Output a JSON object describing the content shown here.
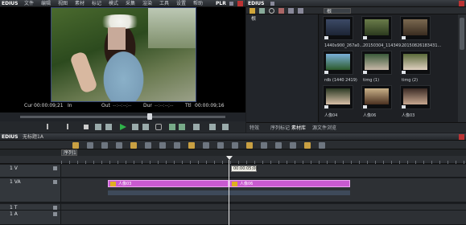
{
  "player": {
    "title_short": "EDIUS",
    "menu": [
      "文件",
      "编辑",
      "视图",
      "素材",
      "标记",
      "模式",
      "采集",
      "渲染",
      "工具",
      "设置",
      "帮助"
    ],
    "mode_label": "PLR",
    "timecodes": {
      "cue_label": "Cur",
      "cue": "00:00:09;21",
      "in_label": "In",
      "out_label": "Out",
      "out": "--:--:--;--",
      "dur_label": "Dur",
      "dur": "--:--:--;--",
      "ttl_label": "Ttl",
      "ttl": "00:00:09;16"
    }
  },
  "bin": {
    "title_short": "EDIUS",
    "folder_label": "根",
    "tree_root": "根",
    "items": [
      {
        "label": "1440x900_267a0...",
        "icon": "still-image-icon"
      },
      {
        "label": "20150304_114349...",
        "icon": "still-image-icon"
      },
      {
        "label": "20150826183431...",
        "icon": "still-image-icon"
      },
      {
        "label": "rdb (1440 2419)",
        "icon": "still-image-icon"
      },
      {
        "label": "timg (1)",
        "icon": "still-image-icon"
      },
      {
        "label": "timg (2)",
        "icon": "still-image-icon"
      },
      {
        "label": "人像04",
        "icon": "still-image-icon"
      },
      {
        "label": "人像06",
        "icon": "still-image-icon"
      },
      {
        "label": "人像03",
        "icon": "still-image-icon"
      }
    ],
    "tabs": [
      "特效",
      "序列标记",
      "素材库",
      "源文件浏览"
    ]
  },
  "timeline": {
    "title_short": "EDIUS",
    "project": "无标题1A",
    "sequence_tab": "序列1",
    "ruler_time": "00:00:05;00",
    "tracks": [
      {
        "name": "1 V",
        "kind": "video"
      },
      {
        "name": "1 VA",
        "kind": "video-audio"
      },
      {
        "name": "1 T",
        "kind": "title"
      },
      {
        "name": "1 A",
        "kind": "audio"
      }
    ],
    "clips": [
      {
        "label": "人像03"
      },
      {
        "label": "人像06"
      }
    ]
  },
  "colors": {
    "accent": "#e0b020",
    "clip": "#c95ad0",
    "timebar": "#ffcc33"
  }
}
